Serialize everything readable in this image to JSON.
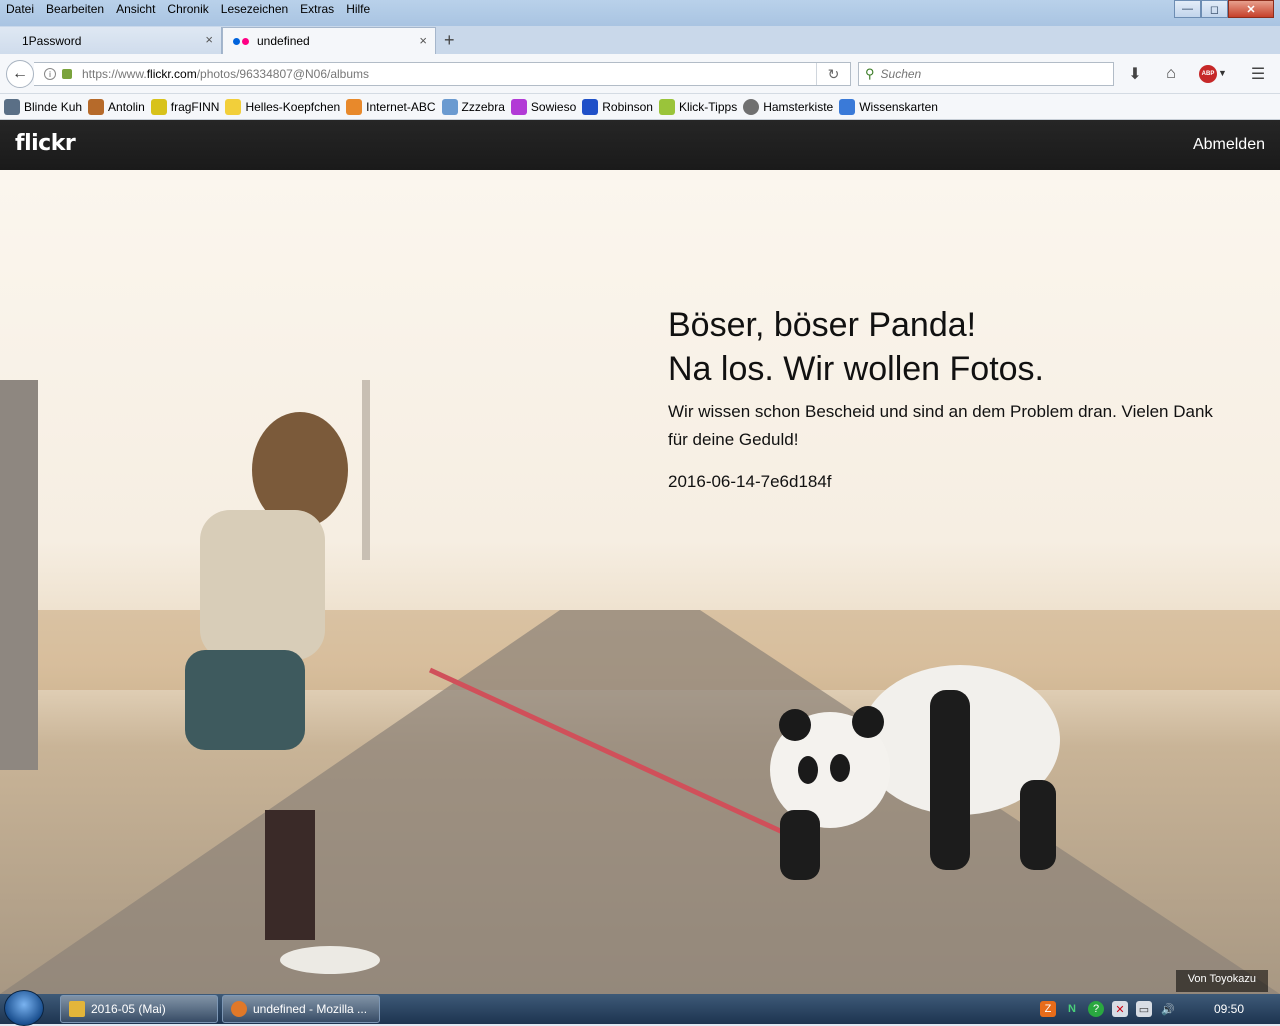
{
  "menu": [
    "Datei",
    "Bearbeiten",
    "Ansicht",
    "Chronik",
    "Lesezeichen",
    "Extras",
    "Hilfe"
  ],
  "window_controls": {
    "minimize": "—",
    "maximize": "◻",
    "close": "✕"
  },
  "tabs": [
    {
      "label": "1Password",
      "close": "×"
    },
    {
      "label": "undefined",
      "close": "×"
    }
  ],
  "new_tab": "+",
  "url": {
    "prefix": "https://www.",
    "domain": "flickr.com",
    "path": "/photos/96334807@N06/albums"
  },
  "search": {
    "placeholder": "Suchen"
  },
  "bookmarks": [
    {
      "label": "Blinde Kuh",
      "color": "#5a6f86"
    },
    {
      "label": "Antolin",
      "color": "#b66a2a"
    },
    {
      "label": "fragFINN",
      "color": "#d8c21a"
    },
    {
      "label": "Helles-Koepfchen",
      "color": "#f2cf3a"
    },
    {
      "label": "Internet-ABC",
      "color": "#e8892b"
    },
    {
      "label": "Zzzebra",
      "color": "#6a9ad0"
    },
    {
      "label": "Sowieso",
      "color": "#b23ad6"
    },
    {
      "label": "Robinson",
      "color": "#2050c8"
    },
    {
      "label": "Klick-Tipps",
      "color": "#9ac43a"
    },
    {
      "label": "Hamsterkiste",
      "color": "#707070"
    },
    {
      "label": "Wissenskarten",
      "color": "#3a7ad8"
    }
  ],
  "flickr": {
    "logo": "flickr",
    "logout": "Abmelden"
  },
  "error": {
    "heading1": "Böser, böser Panda!",
    "heading2": "Na los. Wir wollen Fotos.",
    "message": "Wir wissen schon Bescheid und sind an dem Problem dran. Vielen Dank für deine Geduld!",
    "code": "2016-06-14-7e6d184f",
    "credit": "Von Toyokazu"
  },
  "taskbar": {
    "items": [
      {
        "label": "2016-05 (Mai)",
        "color": "#e3b53a"
      },
      {
        "label": "undefined - Mozilla ...",
        "color": "#e07828"
      }
    ],
    "clock": "09:50"
  }
}
